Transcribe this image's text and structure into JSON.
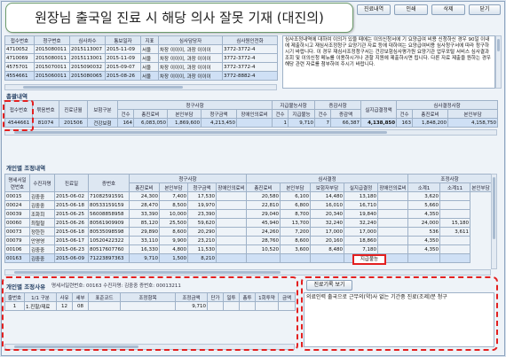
{
  "banner": {
    "title": "원장님 출국일 진료 시 해당 의사 잘못 기재 (대진의)"
  },
  "toolbar": {
    "btn1": "진료내역",
    "btn2": "인쇄",
    "btn3": "삭제",
    "btn4": "닫기"
  },
  "top_table": {
    "headers": [
      "접수번호",
      "청구번호",
      "심사차수",
      "통보일자",
      "지표",
      "심사담당자",
      "심사원인전화"
    ],
    "rows": [
      [
        "4710052",
        "2015080011",
        "2015113007",
        "2015-11-09",
        "서울",
        "차장 이이이, 과장 이이이",
        "3772-3772-4"
      ],
      [
        "4710069",
        "2015080011",
        "2015113001",
        "2015-11-09",
        "서울",
        "차장 이이이, 과장 이이이",
        "3772-3772-4"
      ],
      [
        "4575701",
        "2015070011",
        "2015090032",
        "2015-09-07",
        "서울",
        "차장 이이이, 과장 이이이",
        "3772-3772-4"
      ],
      [
        "4554661",
        "2015060011",
        "2015080065",
        "2015-08-26",
        "서울",
        "차장 이이이, 과장 이이이",
        "3772-8882-4"
      ]
    ]
  },
  "memo_top": "심사조정내역에 대하여 이의가 있을 때에는 이의신청서에 기 요양급여 비용 신청하신 경우 90일 이내에 제출하시고 재심사조정청구 요양기관 자료 등에 대하여는 요양급여비용 심사청구서에 따라 청구하시기 바랍니다. 이 경우 재심사조정청구서는 건강보험심사평가원 요양기관 업무포털 서비스 심사결과 조회 및 이의신청 메뉴를 이용하시거나 관할 지원에 제출하시면 됩니다. 다른 자료 제출을 원하는 경우 해당 관련 자료를 첨부하여 주시기 바랍니다.",
  "claim": {
    "label": "총괄내역",
    "headers_top": [
      "접수번호",
      "묶음번호",
      "진료년월",
      "보험구분",
      "청구사항",
      "지급불능사항",
      "증감사항",
      "심사결정사항"
    ],
    "headers_sub": [
      "건수",
      "총진료비",
      "본인부담",
      "청구금액",
      "장애인의료비",
      "건수",
      "지급불능",
      "건수",
      "증감액",
      "실지급결정액",
      "건수",
      "총진료비",
      "본인부담",
      "보험자부담"
    ],
    "row": [
      "4544661",
      "81074",
      "201506",
      "건강보험",
      "164",
      "6,083,050",
      "1,869,600",
      "4,213,450",
      "",
      "1",
      "9,710",
      "7",
      "66,387",
      "4,138,850",
      "163",
      "1,848,200",
      "4,158,750"
    ]
  },
  "adjust": {
    "label": "개인별 조정내역",
    "headers_top": [
      "명세서일련번호",
      "수진자명",
      "진료일",
      "증번호",
      "청구사항",
      "심사결정",
      "조정사항"
    ],
    "headers_sub": [
      "총진료비",
      "본인부담",
      "청구금액",
      "장애인의료비",
      "총진료비",
      "본인부담",
      "보험자부담",
      "실지급결정",
      "장애인의료비",
      "소계1",
      "소계11",
      "본인부담"
    ],
    "rows": [
      [
        "00015",
        "김중중",
        "2015-06-02",
        "71082591591",
        "24,300",
        "7,400",
        "17,530",
        "",
        "20,580",
        "6,100",
        "14,480",
        "13,180",
        "",
        "3,620",
        ""
      ],
      [
        "00024",
        "김중중",
        "2015-06-18",
        "80533159159",
        "28,470",
        "8,500",
        "19,970",
        "",
        "22,810",
        "6,800",
        "16,010",
        "16,710",
        "",
        "5,660",
        ""
      ],
      [
        "00039",
        "조화희",
        "2015-06-25",
        "56008858958",
        "33,390",
        "10,000",
        "23,390",
        "",
        "29,040",
        "8,700",
        "20,340",
        "19,840",
        "",
        "4,350",
        ""
      ],
      [
        "00060",
        "최철철",
        "2015-06-26",
        "80561909909",
        "85,120",
        "25,500",
        "59,620",
        "",
        "45,940",
        "13,700",
        "32,240",
        "32,240",
        "",
        "24,000",
        "15,180"
      ],
      [
        "00073",
        "정한한",
        "2015-06-18",
        "80535098598",
        "29,890",
        "8,600",
        "20,290",
        "",
        "24,260",
        "7,200",
        "17,000",
        "17,000",
        "",
        "536",
        "3,611"
      ],
      [
        "00079",
        "안영영",
        "2015-06-17",
        "10520422322",
        "33,110",
        "9,900",
        "23,210",
        "",
        "28,760",
        "8,600",
        "20,160",
        "18,860",
        "",
        "4,350",
        ""
      ],
      [
        "00106",
        "김중중",
        "2015-06-23",
        "80517607760",
        "16,330",
        "4,800",
        "11,530",
        "",
        "10,520",
        "3,600",
        "8,480",
        "7,180",
        "",
        "4,350",
        ""
      ],
      [
        "00163",
        "김중중",
        "2015-06-09",
        "71223897363",
        "9,710",
        "1,500",
        "8,210",
        "",
        "",
        "",
        "",
        "",
        "",
        "",
        ""
      ]
    ],
    "unable_label": "지급불능"
  },
  "detail": {
    "label": "개인별 조정사유",
    "info": "명세서일련번호: 00163    수진자명: 김중중    증번호: 00013211",
    "headers": [
      "줄번호",
      "1/1 구분",
      "사유",
      "세부",
      "표준코드",
      "조정항목",
      "조정금액",
      "단가",
      "일투",
      "총투",
      "1회투약",
      "금액"
    ],
    "row": [
      "1",
      "1.진찰/재료",
      "12",
      "08",
      "",
      "",
      "9,710",
      "",
      "",
      "",
      "",
      ""
    ]
  },
  "right_panel": {
    "label": "진료기록 보기",
    "text": "의료인력 출국으로 근무의(약)사 없는 기간중 진료(조제)분 청구"
  }
}
